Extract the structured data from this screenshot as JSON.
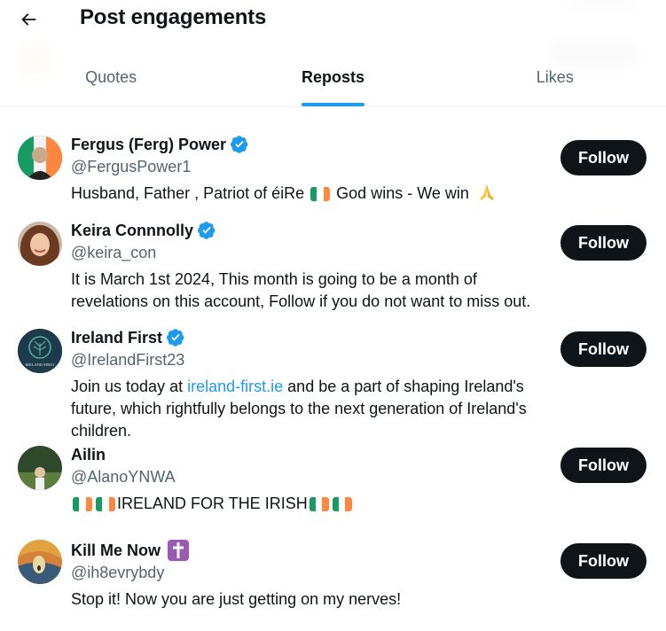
{
  "header": {
    "title": "Post engagements",
    "tabs": [
      {
        "label": "Quotes",
        "active": false
      },
      {
        "label": "Reposts",
        "active": true
      },
      {
        "label": "Likes",
        "active": false
      }
    ]
  },
  "colors": {
    "accent": "#1d9bf0",
    "text": "#0f1419",
    "muted": "#536471",
    "button": "#0f1419"
  },
  "users": [
    {
      "name": "Fergus (Ferg) Power",
      "verified": true,
      "handle": "@FergusPower1",
      "bio_1": "Husband, Father , Patriot of éiRe",
      "bio_2": "God wins - We win",
      "follow_label": "Follow"
    },
    {
      "name": "Keira Connnolly",
      "verified": true,
      "handle": "@keira_con",
      "bio": "It is March 1st 2024, This month is going to be a month of revelations on this account, Follow if you do not want to miss out.",
      "follow_label": "Follow"
    },
    {
      "name": "Ireland First",
      "verified": true,
      "handle": "@IrelandFirst23",
      "bio_pre": "Join us today at",
      "bio_link": "ireland-first.ie",
      "bio_post": "and be a part of shaping Ireland's future, which rightfully belongs to the next generation of Ireland's children.",
      "avatar_text": "IRELAND FIRST",
      "follow_label": "Follow"
    },
    {
      "name": "Ailin",
      "verified": false,
      "handle": "@AlanoYNWA",
      "bio": "IRELAND FOR THE IRISH",
      "follow_label": "Follow"
    },
    {
      "name": "Kill Me Now",
      "verified": false,
      "handle": "@ih8evrybdy",
      "bio": "Stop it! Now you are just getting on my nerves!",
      "follow_label": "Follow"
    }
  ]
}
